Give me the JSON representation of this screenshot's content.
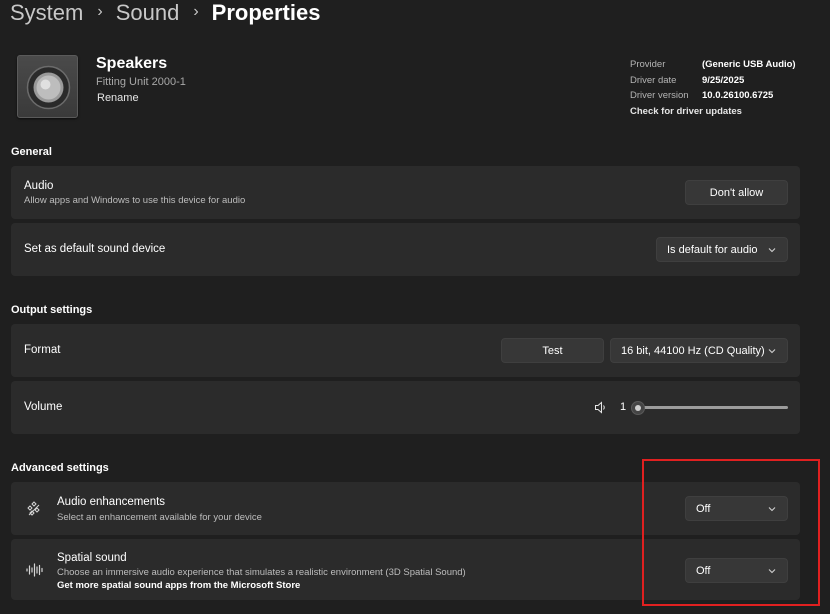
{
  "breadcrumb": {
    "items": [
      "System",
      "Sound",
      "Properties"
    ],
    "separator": "›"
  },
  "device": {
    "name": "Speakers",
    "model": "Fitting Unit 2000-1",
    "rename_label": "Rename"
  },
  "driver": {
    "provider_label": "Provider",
    "provider_value": "(Generic USB Audio)",
    "date_label": "Driver date",
    "date_value": "9/25/2025",
    "version_label": "Driver version",
    "version_value": "10.0.26100.6725",
    "check_updates_label": "Check for driver updates"
  },
  "general": {
    "title": "General",
    "audio": {
      "title": "Audio",
      "description": "Allow apps and Windows to use this device for audio",
      "button_label": "Don't allow"
    },
    "default_device": {
      "title": "Set as default sound device",
      "dropdown_value": "Is default for audio"
    }
  },
  "output": {
    "title": "Output settings",
    "format": {
      "title": "Format",
      "test_label": "Test",
      "dropdown_value": "16 bit, 44100 Hz (CD Quality)"
    },
    "volume": {
      "title": "Volume",
      "value": "1"
    }
  },
  "advanced": {
    "title": "Advanced settings",
    "enhancements": {
      "title": "Audio enhancements",
      "description": "Select an enhancement available for your device",
      "dropdown_value": "Off"
    },
    "spatial": {
      "title": "Spatial sound",
      "description": "Choose an immersive audio experience that simulates a realistic environment (3D Spatial Sound)",
      "link": "Get more spatial sound apps from the Microsoft Store",
      "dropdown_value": "Off"
    }
  },
  "icons": [
    "chevron-right-icon",
    "speaker-device-icon",
    "chevron-down-icon",
    "volume-icon",
    "enhancements-icon",
    "spatial-sound-icon"
  ],
  "colors": {
    "background": "#1f1f1f",
    "card": "#2b2b2b",
    "control": "#373737",
    "highlight": "#e02020"
  }
}
